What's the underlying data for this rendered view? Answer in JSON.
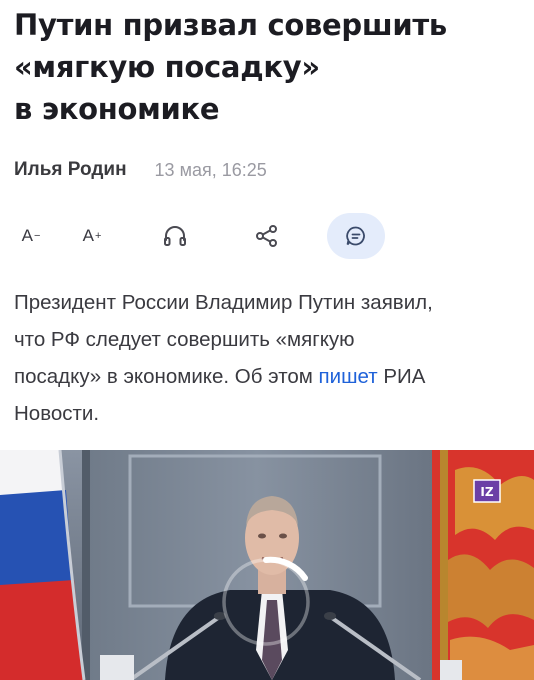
{
  "article": {
    "headline_lines": [
      "Путин призвал совершить",
      "«мягкую посадку»",
      "в экономике"
    ],
    "author": "Илья Родин",
    "date": "13 мая, 16:25",
    "body": {
      "line1": "Президент России Владимир Путин заявил,",
      "line2": "что РФ следует совершить «мягкую",
      "line3_before": "посадку» в экономике. Об этом ",
      "line3_link": "пишет",
      "line3_after": " РИА",
      "line4": "Новости."
    }
  },
  "toolbar": {
    "font_decrease": "A",
    "font_decrease_sign": "−",
    "font_increase": "A",
    "font_increase_sign": "+",
    "icons": [
      "headphones-icon",
      "share-icon",
      "comment-icon"
    ]
  },
  "video": {
    "channel_badge": "IZ",
    "state": "loading",
    "icons": [
      "loading-spinner-icon"
    ]
  },
  "colors": {
    "link": "#1f62d9",
    "comment_button_bg": "#e4ecfb",
    "date": "#9a9aa2",
    "badge": "#6b3fa6"
  }
}
